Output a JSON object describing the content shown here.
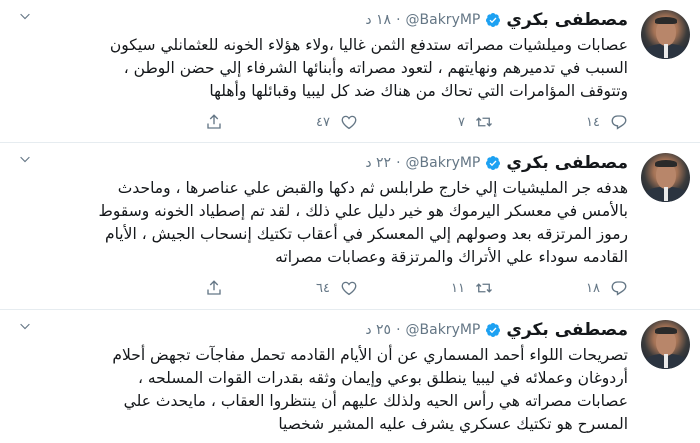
{
  "tweets": [
    {
      "author_name": "مصطفى بكري",
      "handle": "@BakryMP",
      "separator": "·",
      "time": "١٨ د",
      "lines": [
        "عصابات وميلشيات مصراته ستدفع الثمن غاليا ،ولاء هؤلاء الخونه للعثمانلي سيكون",
        "السبب في تدميرهم ونهايتهم ، لتعود مصراته وأبنائها الشرفاء إلي حضن الوطن ،",
        "وتتوقف المؤامرات التي تحاك من هناك ضد كل ليبيا وقبائلها وأهلها"
      ],
      "replies": "١٤",
      "retweets": "٧",
      "likes": "٤٧"
    },
    {
      "author_name": "مصطفى بكري",
      "handle": "@BakryMP",
      "separator": "·",
      "time": "٢٢ د",
      "lines": [
        "هدفه جر المليشيات إلي خارج طرابلس ثم دكها والقبض علي عناصرها ، وماحدث",
        "بالأمس في معسكر اليرموك هو خير دليل علي ذلك ، لقد تم إصطياد الخونه وسقوط",
        "رموز المرتزقه بعد وصولهم إلي المعسكر في أعقاب تكتيك إنسحاب الجيش ، الأيام",
        "القادمه سوداء علي الأتراك والمرتزقة وعصابات مصراته"
      ],
      "replies": "١٨",
      "retweets": "١١",
      "likes": "٦٤"
    },
    {
      "author_name": "مصطفى بكري",
      "handle": "@BakryMP",
      "separator": "·",
      "time": "٢٥ د",
      "lines": [
        "تصريحات اللواء أحمد المسماري عن أن الأيام القادمه تحمل مفاجآت تجهض أحلام",
        "أردوغان وعملائه في ليبيا ينطلق بوعي وإيمان وثقه بقدرات القوات المسلحه ،",
        "عصابات مصراته هي رأس الحيه ولذلك عليهم أن ينتظروا العقاب ، مايحدث علي",
        "المسرح هو تكتيك عسكري يشرف عليه المشير شخصيا"
      ],
      "replies": "",
      "retweets": "",
      "likes": ""
    }
  ],
  "icons": {
    "verified": "verified-badge-icon",
    "caret": "chevron-down-icon",
    "reply": "reply-icon",
    "retweet": "retweet-icon",
    "like": "heart-icon",
    "share": "share-icon"
  },
  "colors": {
    "verified": "#1da1f2",
    "text": "#14171a",
    "muted": "#657786",
    "divider": "#e6ecf0"
  }
}
